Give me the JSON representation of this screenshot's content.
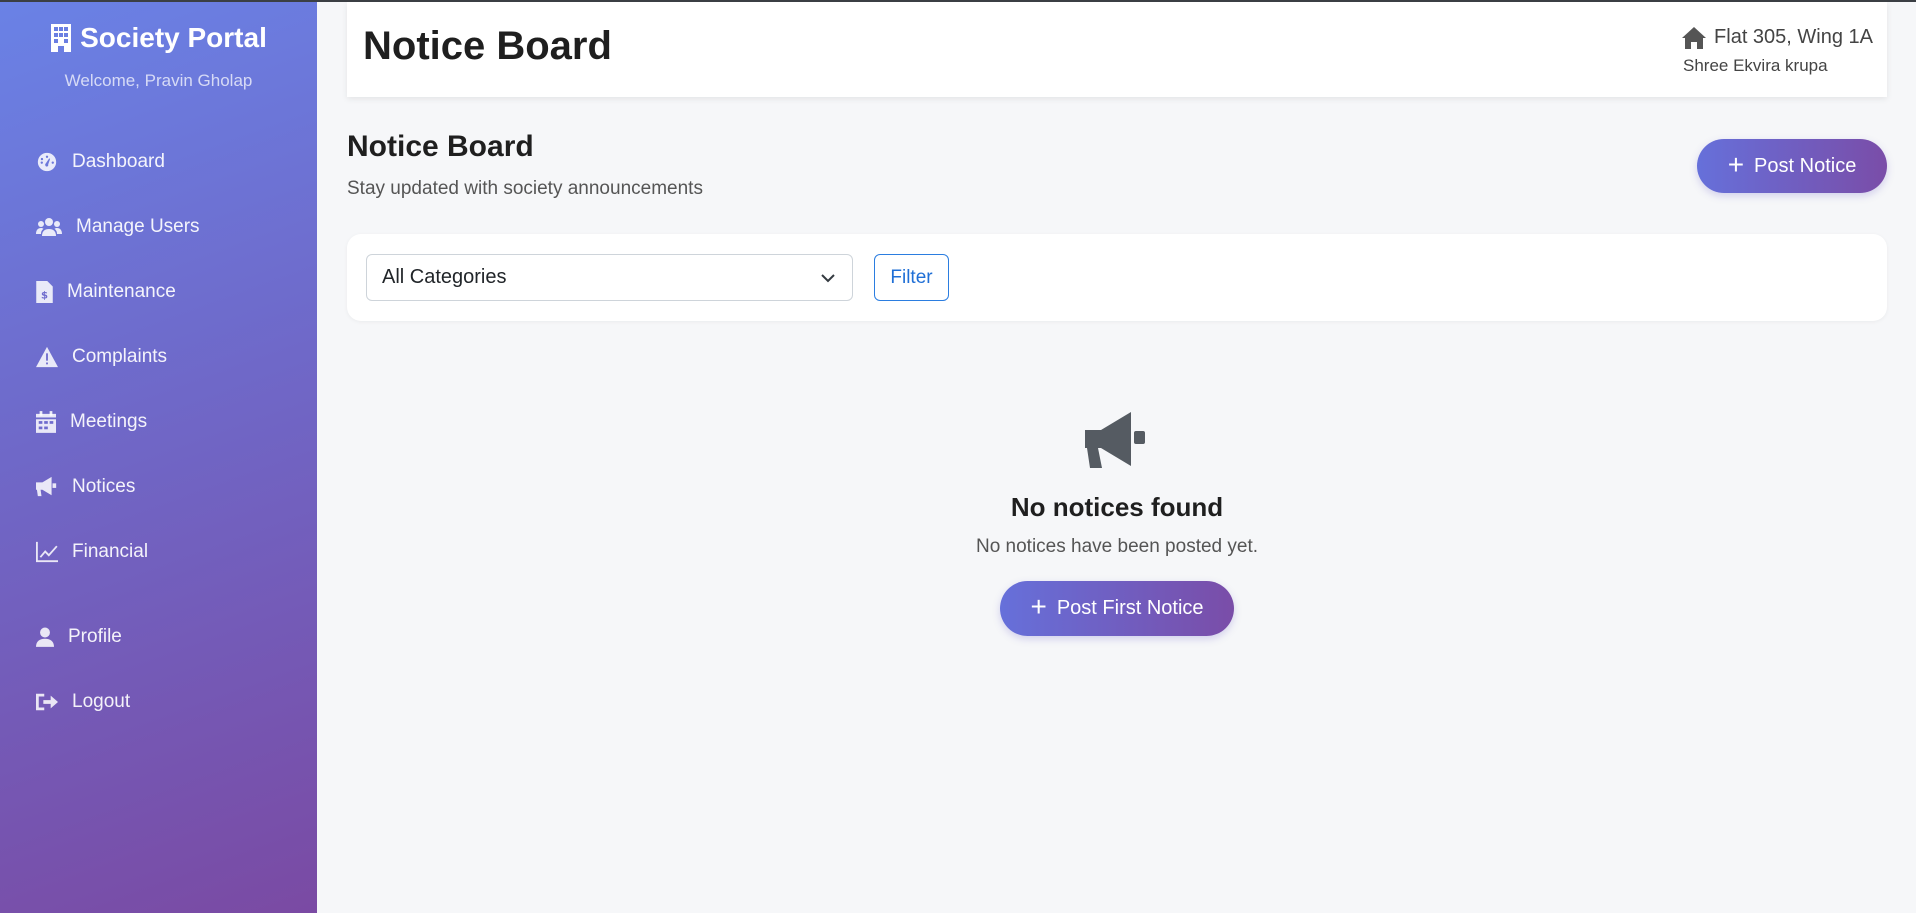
{
  "sidebar": {
    "brand": "Society Portal",
    "welcome": "Welcome, Pravin Gholap",
    "items": [
      {
        "label": "Dashboard",
        "icon": "dashboard-icon"
      },
      {
        "label": "Manage Users",
        "icon": "users-icon"
      },
      {
        "label": "Maintenance",
        "icon": "invoice-dollar-icon"
      },
      {
        "label": "Complaints",
        "icon": "warning-icon"
      },
      {
        "label": "Meetings",
        "icon": "calendar-icon"
      },
      {
        "label": "Notices",
        "icon": "megaphone-icon"
      },
      {
        "label": "Financial",
        "icon": "line-chart-icon"
      },
      {
        "label": "Profile",
        "icon": "user-icon"
      },
      {
        "label": "Logout",
        "icon": "sign-out-icon"
      }
    ]
  },
  "header": {
    "title": "Notice Board",
    "flat": "Flat 305, Wing 1A",
    "society": "Shree Ekvira krupa"
  },
  "page": {
    "title": "Notice Board",
    "subtitle": "Stay updated with society announcements",
    "post_button": "Post Notice"
  },
  "filter": {
    "selected_category": "All Categories",
    "button": "Filter"
  },
  "empty_state": {
    "icon": "megaphone-icon",
    "title": "No notices found",
    "message": "No notices have been posted yet.",
    "button": "Post First Notice"
  },
  "colors": {
    "sidebar_gradient_start": "#6a82e6",
    "sidebar_gradient_end": "#7a4aa3",
    "button_gradient_start": "#6670da",
    "button_gradient_end": "#7a4da8",
    "filter_button": "#2b7de0"
  }
}
